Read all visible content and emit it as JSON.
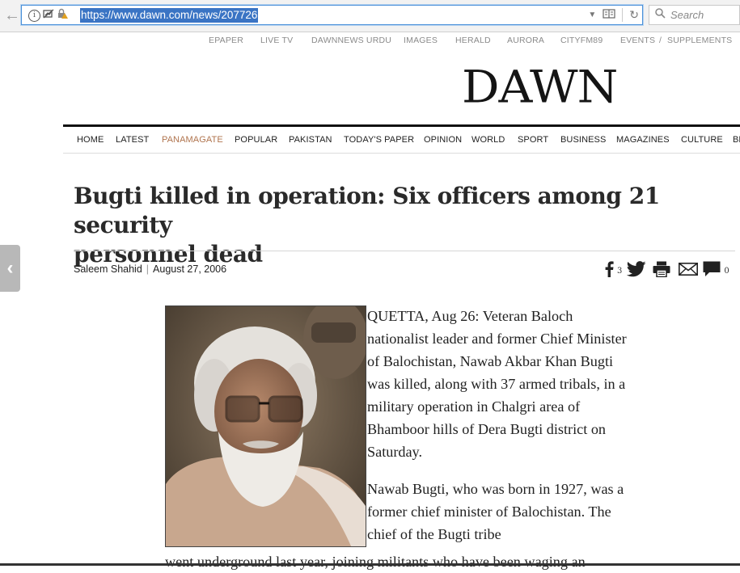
{
  "browser": {
    "url": "https://www.dawn.com/news/207726",
    "search_placeholder": "Search"
  },
  "top_links": [
    "EPAPER",
    "LIVE TV",
    "DAWNNEWS URDU",
    "IMAGES",
    "HERALD",
    "AURORA",
    "CITYFM89",
    "EVENTS",
    "/",
    "SUPPLEMENTS"
  ],
  "logo": "DAWN",
  "nav": [
    "HOME",
    "LATEST",
    "PANAMAGATE",
    "POPULAR",
    "PAKISTAN",
    "TODAY'S PAPER",
    "OPINION",
    "WORLD",
    "SPORT",
    "BUSINESS",
    "MAGAZINES",
    "CULTURE",
    "BL"
  ],
  "article": {
    "headline_line1": "Bugti killed in operation: Six officers among 21 security",
    "headline_line2": "personnel dead",
    "author": "Saleem Shahid",
    "date": "August 27, 2006",
    "share_fb_count": "3",
    "comment_count": "0",
    "para1": "QUETTA, Aug 26: Veteran Baloch nationalist leader and former Chief Minister of Balochistan, Nawab Akbar Khan Bugti was killed, along with 37 armed tribals, in a military operation in Chalgri area of Bhamboor hills of Dera Bugti district on Saturday.",
    "para2": "Nawab Bugti, who was born in 1927, was a former chief minister of Balochistan. The chief of the Bugti tribe",
    "para2_cont": "went underground last year, joining militants who have been waging an"
  },
  "colors": {
    "accent_nav": "#b0744e",
    "url_highlight": "#3a74c4",
    "focus_border": "#4a90d9"
  }
}
